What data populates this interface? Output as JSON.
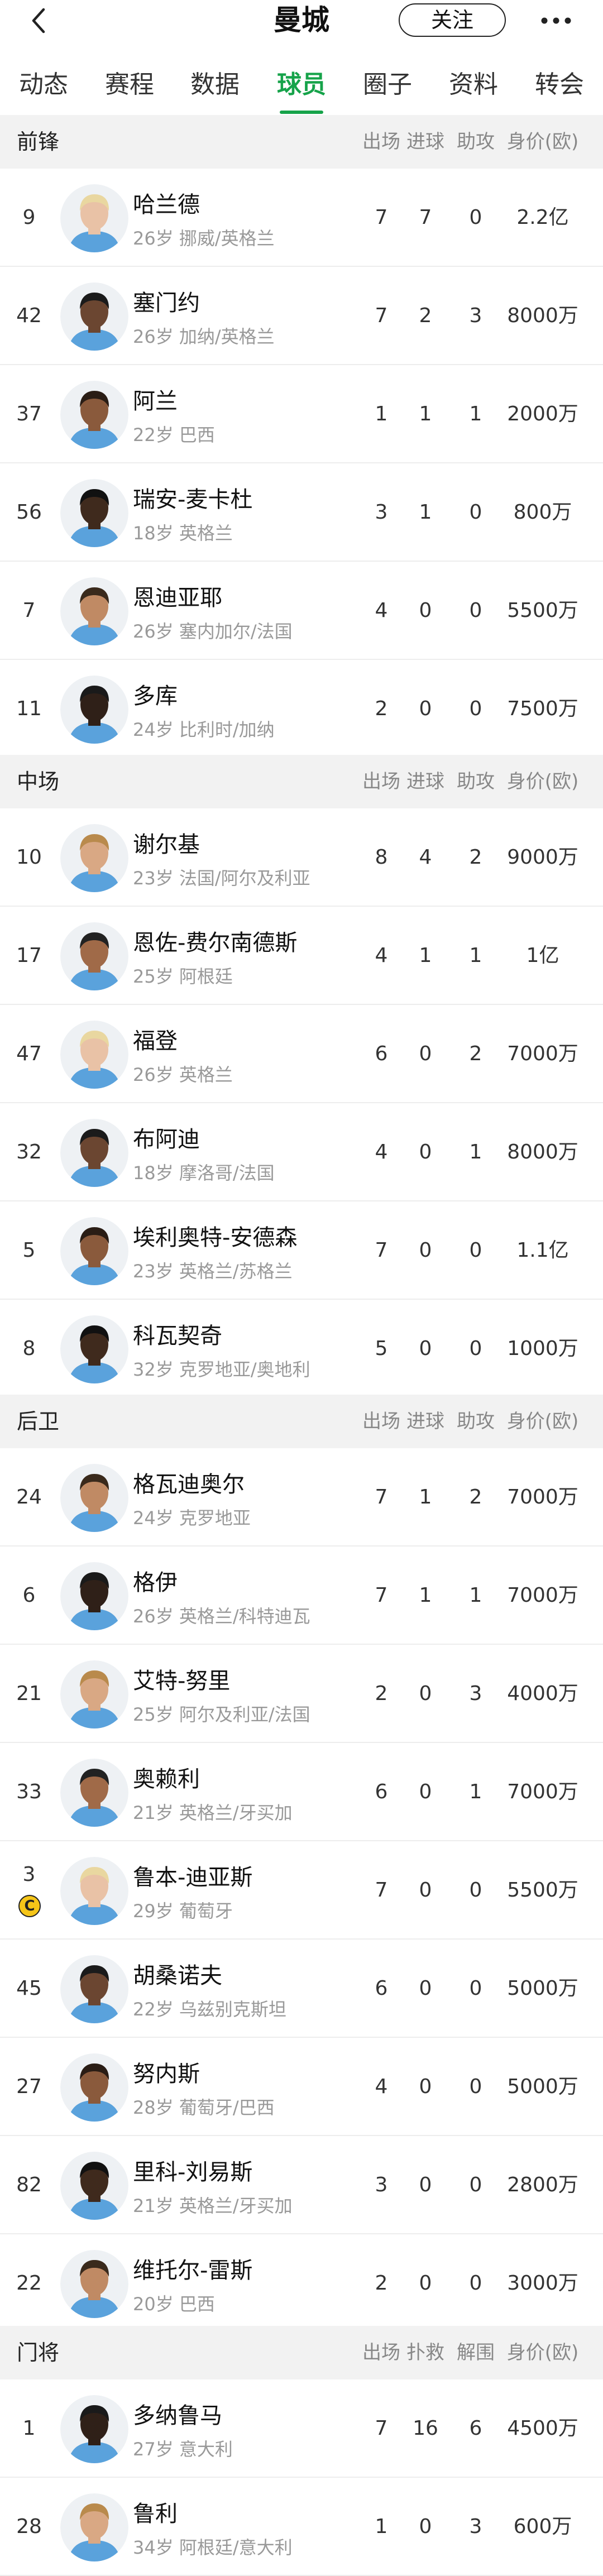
{
  "header": {
    "title": "曼城",
    "follow_label": "关注"
  },
  "tabs": [
    "动态",
    "赛程",
    "数据",
    "球员",
    "圈子",
    "资料",
    "转会"
  ],
  "active_tab": 3,
  "sections": [
    {
      "title": "前锋",
      "columns": [
        "出场",
        "进球",
        "助攻",
        "身价(欧)"
      ],
      "players": [
        {
          "number": "9",
          "name": "哈兰德",
          "info": "26岁 挪威/英格兰",
          "stats": [
            "7",
            "7",
            "0",
            "2.2亿"
          ]
        },
        {
          "number": "42",
          "name": "塞门约",
          "info": "26岁 加纳/英格兰",
          "stats": [
            "7",
            "2",
            "3",
            "8000万"
          ]
        },
        {
          "number": "37",
          "name": "阿兰",
          "info": "22岁 巴西",
          "stats": [
            "1",
            "1",
            "1",
            "2000万"
          ]
        },
        {
          "number": "56",
          "name": "瑞安-麦卡杜",
          "info": "18岁 英格兰",
          "stats": [
            "3",
            "1",
            "0",
            "800万"
          ]
        },
        {
          "number": "7",
          "name": "恩迪亚耶",
          "info": "26岁 塞内加尔/法国",
          "stats": [
            "4",
            "0",
            "0",
            "5500万"
          ]
        },
        {
          "number": "11",
          "name": "多库",
          "info": "24岁 比利时/加纳",
          "stats": [
            "2",
            "0",
            "0",
            "7500万"
          ]
        }
      ]
    },
    {
      "title": "中场",
      "columns": [
        "出场",
        "进球",
        "助攻",
        "身价(欧)"
      ],
      "players": [
        {
          "number": "10",
          "name": "谢尔基",
          "info": "23岁 法国/阿尔及利亚",
          "stats": [
            "8",
            "4",
            "2",
            "9000万"
          ]
        },
        {
          "number": "17",
          "name": "恩佐-费尔南德斯",
          "info": "25岁 阿根廷",
          "stats": [
            "4",
            "1",
            "1",
            "1亿"
          ]
        },
        {
          "number": "47",
          "name": "福登",
          "info": "26岁 英格兰",
          "stats": [
            "6",
            "0",
            "2",
            "7000万"
          ]
        },
        {
          "number": "32",
          "name": "布阿迪",
          "info": "18岁 摩洛哥/法国",
          "stats": [
            "4",
            "0",
            "1",
            "8000万"
          ]
        },
        {
          "number": "5",
          "name": "埃利奥特-安德森",
          "info": "23岁 英格兰/苏格兰",
          "stats": [
            "7",
            "0",
            "0",
            "1.1亿"
          ]
        },
        {
          "number": "8",
          "name": "科瓦契奇",
          "info": "32岁 克罗地亚/奥地利",
          "stats": [
            "5",
            "0",
            "0",
            "1000万"
          ]
        }
      ]
    },
    {
      "title": "后卫",
      "columns": [
        "出场",
        "进球",
        "助攻",
        "身价(欧)"
      ],
      "players": [
        {
          "number": "24",
          "name": "格瓦迪奥尔",
          "info": "24岁 克罗地亚",
          "stats": [
            "7",
            "1",
            "2",
            "7000万"
          ]
        },
        {
          "number": "6",
          "name": "格伊",
          "info": "26岁 英格兰/科特迪瓦",
          "stats": [
            "7",
            "1",
            "1",
            "7000万"
          ]
        },
        {
          "number": "21",
          "name": "艾特-努里",
          "info": "25岁 阿尔及利亚/法国",
          "stats": [
            "2",
            "0",
            "3",
            "4000万"
          ]
        },
        {
          "number": "33",
          "name": "奥赖利",
          "info": "21岁 英格兰/牙买加",
          "stats": [
            "6",
            "0",
            "1",
            "7000万"
          ]
        },
        {
          "number": "3",
          "captain": true,
          "captain_label": "C",
          "name": "鲁本-迪亚斯",
          "info": "29岁 葡萄牙",
          "stats": [
            "7",
            "0",
            "0",
            "5500万"
          ]
        },
        {
          "number": "45",
          "name": "胡桑诺夫",
          "info": "22岁 乌兹别克斯坦",
          "stats": [
            "6",
            "0",
            "0",
            "5000万"
          ]
        },
        {
          "number": "27",
          "name": "努内斯",
          "info": "28岁 葡萄牙/巴西",
          "stats": [
            "4",
            "0",
            "0",
            "5000万"
          ]
        },
        {
          "number": "82",
          "name": "里科-刘易斯",
          "info": "21岁 英格兰/牙买加",
          "stats": [
            "3",
            "0",
            "0",
            "2800万"
          ]
        },
        {
          "number": "22",
          "name": "维托尔-雷斯",
          "info": "20岁 巴西",
          "stats": [
            "2",
            "0",
            "0",
            "3000万"
          ]
        }
      ]
    },
    {
      "title": "门将",
      "columns": [
        "出场",
        "扑救",
        "解围",
        "身价(欧)"
      ],
      "players": [
        {
          "number": "1",
          "name": "多纳鲁马",
          "info": "27岁 意大利",
          "stats": [
            "7",
            "16",
            "6",
            "4500万"
          ]
        },
        {
          "number": "28",
          "name": "鲁利",
          "info": "34岁 阿根廷/意大利",
          "stats": [
            "1",
            "0",
            "3",
            "600万"
          ]
        }
      ]
    }
  ],
  "colors": {
    "accent": "#16a34a",
    "section_bg": "#f2f2f2",
    "muted_text": "#999999",
    "captain_badge": "#f5c518"
  }
}
